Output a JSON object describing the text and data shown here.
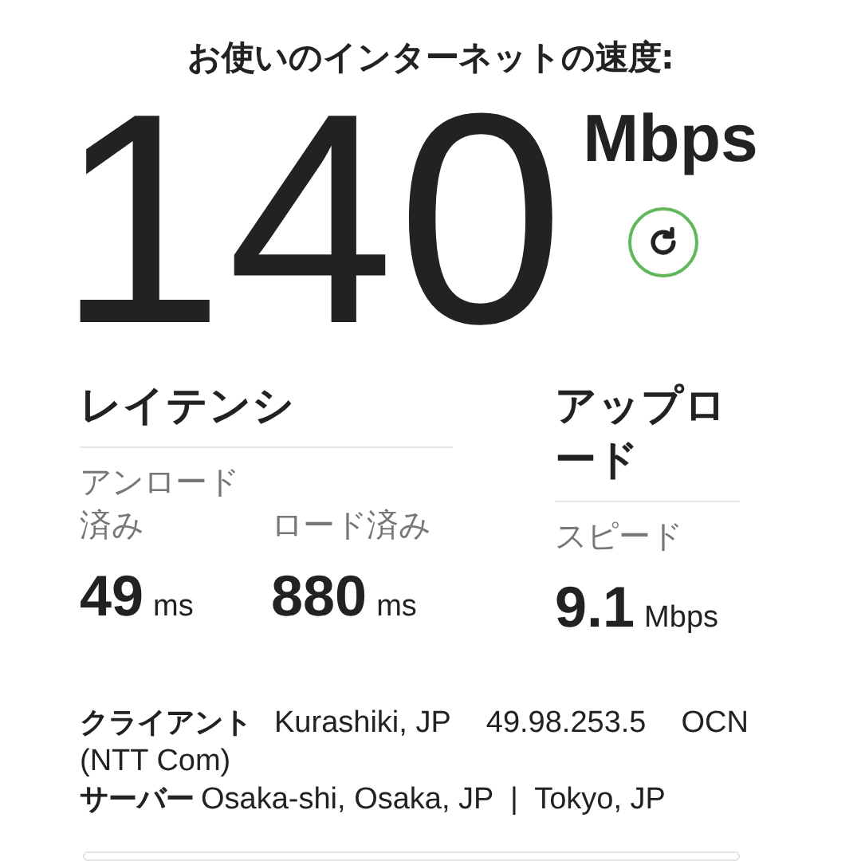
{
  "heading": "お使いのインターネットの速度:",
  "speed": {
    "value": "140",
    "unit": "Mbps"
  },
  "latency": {
    "title": "レイテンシ",
    "metrics": [
      {
        "label": "アンロード済み",
        "value": "49",
        "unit": "ms"
      },
      {
        "label": "ロード済み",
        "value": "880",
        "unit": "ms"
      }
    ]
  },
  "upload": {
    "title": "アップロード",
    "metrics": [
      {
        "label": "スピード",
        "value": "9.1",
        "unit": "Mbps"
      }
    ]
  },
  "client": {
    "label": "クライアント",
    "location": "Kurashiki, JP",
    "ip": "49.98.253.5",
    "isp": "OCN (NTT Com)"
  },
  "server": {
    "label": "サーバー",
    "locations": "Osaka-shi, Osaka, JP  |  Tokyo, JP"
  }
}
